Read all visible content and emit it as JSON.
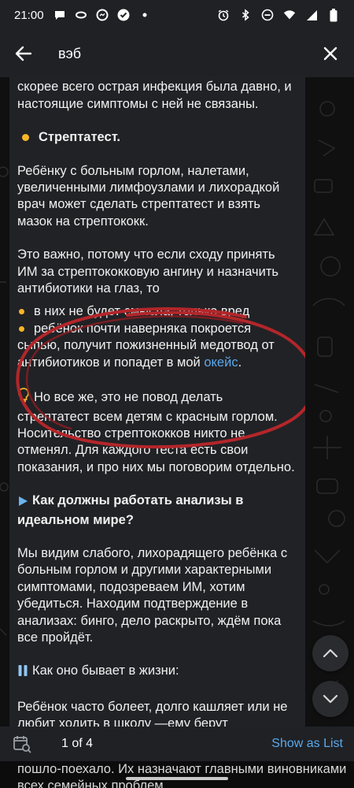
{
  "status_bar": {
    "time": "21:00",
    "left_icons": [
      "chat-bubble-icon",
      "infinity-icon",
      "messenger-icon",
      "check-circle-icon",
      "dot-icon"
    ],
    "right_icons": [
      "alarm-icon",
      "bluetooth-icon",
      "do-not-disturb-icon",
      "wifi-icon",
      "signal-icon",
      "battery-icon"
    ]
  },
  "search_header": {
    "query": "вэб",
    "back_icon": "arrow-left-icon",
    "close_icon": "close-icon"
  },
  "message": {
    "partial_top": "Если нашлись ядерные anti-EBNA IgG, скорее всего острая инфекция была давно, и настоящие симптомы с ней не связаны.",
    "heading_strep": "Стрептатест.",
    "para_strep": "Ребёнку с больным горлом, налетами, увеличенными лимфоузлами и лихорадкой врач может сделать стрептатест и взять мазок на стрептококк.",
    "para_important": "Это важно, потому что если сходу принять ИМ за стрептококковую ангину и назначить антибиотики на глаз, то",
    "bullet_1": "в них не будет смысла, только вред",
    "bullet_2_main": "ребёнок почти наверняка покроется сыпью, получит пожизненный медотвод от антибиотиков и попадет в мой ",
    "bullet_2_link": "окейс",
    "bullet_2_end": ".",
    "para_however": "Но все же, это не повод делать стрептатест всем детям с красным горлом. Носительство стрептококков никто не отменял. Для каждого теста есть свои показания, и про них мы поговорим отдельно.",
    "heading_ideal": "Как должны работать анализы в идеальном мире?",
    "para_ideal": "Мы видим слабого, лихорадящего ребёнка с больным горлом и другими характерными симптомами, подозреваем ИМ, хотим убедиться. Находим подтверждение в анализах: бинго, дело раскрыто, ждём пока все пройдёт.",
    "heading_life": "Как оно бывает в жизни:",
    "para_life": "Ребёнок часто болеет, долго кашляет или не любит ходить в школу —ему берут"
  },
  "behind_text": "пошло-поехало. Их назначают главными виновниками всех семейных проблем,",
  "results_bar": {
    "count": "1 of 4",
    "show_list": "Show as List",
    "calendar_icon": "calendar-search-icon"
  },
  "colors": {
    "accent": "#5aa9ec",
    "bullet": "#f6b626",
    "bubble": "#212226",
    "header": "#1f2125",
    "scribble": "#b3262a"
  }
}
